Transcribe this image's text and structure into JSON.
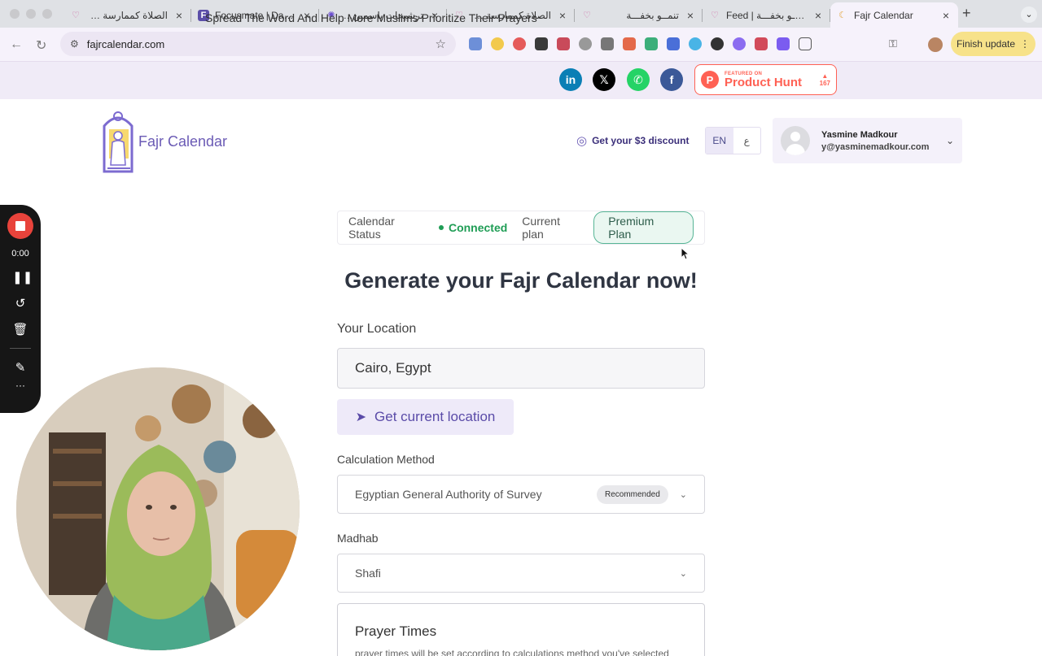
{
  "browser": {
    "tabs": [
      {
        "title": "الصلاة كممارسة جسدي",
        "favicon_color": "#d06fa8",
        "active": false
      },
      {
        "title": "Focusmate | Dashb",
        "favicon_color": "#5b4ea8",
        "favicon_letter": "F",
        "active": false
      },
      {
        "title": "ترشيحات ياسمين: تطب",
        "favicon_color": "#6c4fcf",
        "active": false
      },
      {
        "title": "الصلاة كممارسة جسدي",
        "favicon_color": "#d06fa8",
        "active": false
      },
      {
        "title": "تنمــو بخفـــة",
        "favicon_color": "#d06fa8",
        "active": false
      },
      {
        "title": "Feed | تنمــو بخفـــة",
        "favicon_color": "#d06fa8",
        "active": false
      },
      {
        "title": "Fajr Calendar",
        "favicon_color": "#e3a53b",
        "active": true
      }
    ],
    "url": "fajrcalendar.com",
    "finish_update_label": "Finish update"
  },
  "promo": {
    "text": "Spread The Word And Help More Muslims Prioritize Their Prayers",
    "social": [
      {
        "name": "linkedin",
        "glyph": "in",
        "color": "#0a7fb5"
      },
      {
        "name": "x",
        "glyph": "𝕏",
        "color": "#000000"
      },
      {
        "name": "whatsapp",
        "glyph": "✆",
        "color": "#25d366"
      },
      {
        "name": "facebook",
        "glyph": "f",
        "color": "#3b5998"
      }
    ],
    "product_hunt": {
      "featured": "FEATURED ON",
      "name": "Product Hunt",
      "votes": "167"
    }
  },
  "header": {
    "brand": "Fajr Calendar",
    "discount": "Get your $3 discount",
    "lang_en": "EN",
    "lang_ar": "ع",
    "user_name": "Yasmine Madkour",
    "user_email": "y@yasminemadkour.com"
  },
  "status": {
    "label": "Calendar Status",
    "state": "Connected",
    "plan_label": "Current plan",
    "plan": "Premium Plan"
  },
  "main": {
    "title": "Generate your Fajr Calendar now!",
    "location_label": "Your Location",
    "location_value": "Cairo, Egypt",
    "geo_button": "Get current location",
    "method_label": "Calculation Method",
    "method_value": "Egyptian General Authority of Survey",
    "method_badge": "Recommended",
    "madhab_label": "Madhab",
    "madhab_value": "Shafi",
    "prayer_title": "Prayer Times",
    "prayer_sub": "prayer times will be set according to calculations method you've selected"
  },
  "recorder": {
    "time": "0:00"
  },
  "colors": {
    "accent": "#6b5bb5",
    "connected": "#1f9d55",
    "record": "#e8433b"
  }
}
